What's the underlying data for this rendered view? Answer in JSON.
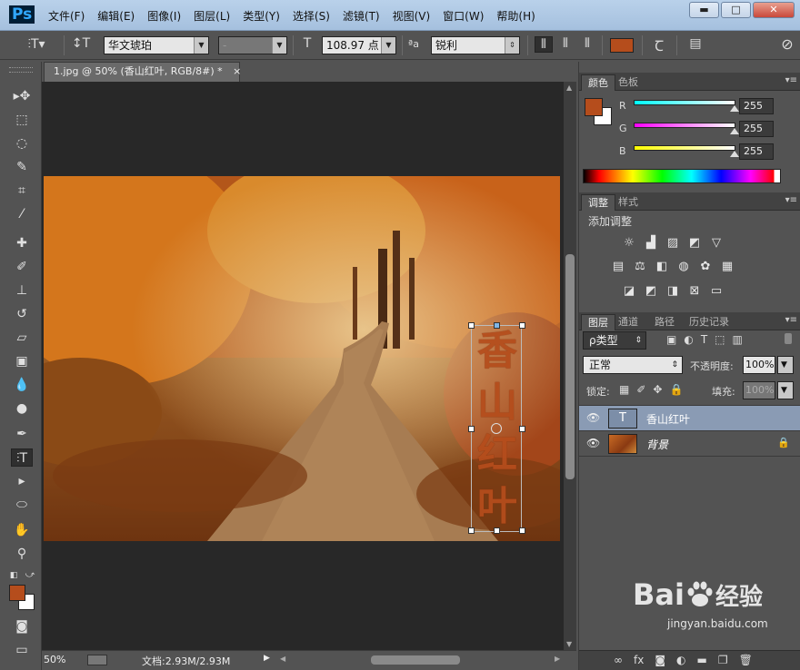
{
  "app": {
    "logo": "Ps"
  },
  "menu": [
    "文件(F)",
    "编辑(E)",
    "图像(I)",
    "图层(L)",
    "类型(Y)",
    "选择(S)",
    "滤镜(T)",
    "视图(V)",
    "窗口(W)",
    "帮助(H)"
  ],
  "window_buttons": {
    "minimize": "▬",
    "maximize": "□",
    "close": "✕"
  },
  "options": {
    "font_family": "华文琥珀",
    "font_style": "-",
    "font_size": "108.97 点",
    "aa_label": "ªa",
    "antialias": "锐利",
    "text_color": "#b54d1c"
  },
  "document": {
    "tab_title": "1.jpg @ 50% (香山红叶, RGB/8#) *",
    "tab_close": "×",
    "vertical_text": [
      "香",
      "山",
      "红",
      "叶"
    ]
  },
  "status": {
    "zoom": "50%",
    "doc_info": "文档:2.93M/2.93M",
    "arrow": "▶"
  },
  "color_panel": {
    "tabs": [
      "颜色",
      "色板"
    ],
    "channels": [
      {
        "label": "R",
        "value": "255",
        "gradient": "#00ffff"
      },
      {
        "label": "G",
        "value": "255",
        "gradient": "#ff00ff"
      },
      {
        "label": "B",
        "value": "255",
        "gradient": "#ffff00"
      }
    ],
    "fg": "#b54d1c",
    "bg": "#ffffff"
  },
  "adjust_panel": {
    "tabs": [
      "调整",
      "样式"
    ],
    "title": "添加调整"
  },
  "layers_panel": {
    "tabs": [
      "图层",
      "通道",
      "路径",
      "历史记录"
    ],
    "filter": "ρ类型",
    "blend_mode": "正常",
    "opacity_label": "不透明度:",
    "opacity": "100%",
    "lock_label": "锁定:",
    "fill_label": "填充:",
    "fill": "100%",
    "layers": [
      {
        "name": "香山红叶",
        "type": "text",
        "thumb": "T",
        "selected": true
      },
      {
        "name": "背景",
        "type": "image",
        "selected": false
      }
    ]
  },
  "watermark": {
    "brand": "Bai",
    "cn": "经验",
    "url": "jingyan.baidu.com"
  }
}
